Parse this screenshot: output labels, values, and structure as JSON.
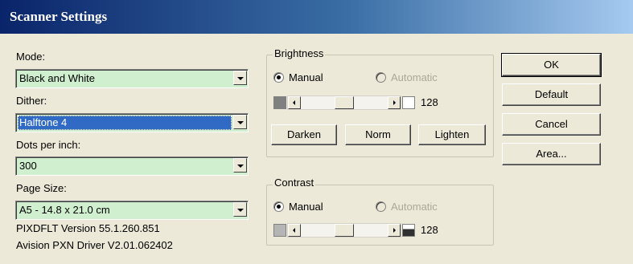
{
  "window": {
    "title": "Scanner Settings"
  },
  "left": {
    "mode_label": "Mode:",
    "mode_value": "Black and White",
    "dither_label": "Dither:",
    "dither_value": "Halftone 4",
    "dpi_label": "Dots per inch:",
    "dpi_value": "300",
    "pagesize_label": "Page Size:",
    "pagesize_value": "A5 - 14.8 x 21.0 cm",
    "version_line1": "PIXDFLT Version 55.1.260.851",
    "version_line2": "Avision PXN Driver V2.01.062402"
  },
  "brightness": {
    "legend": "Brightness",
    "manual_label": "Manual",
    "automatic_label": "Automatic",
    "mode_selected": "Manual",
    "value": "128",
    "darken_label": "Darken",
    "norm_label": "Norm",
    "lighten_label": "Lighten"
  },
  "contrast": {
    "legend": "Contrast",
    "manual_label": "Manual",
    "automatic_label": "Automatic",
    "mode_selected": "Manual",
    "value": "128"
  },
  "buttons": {
    "ok": "OK",
    "default": "Default",
    "cancel": "Cancel",
    "area": "Area..."
  },
  "colors": {
    "title_gradient_start": "#0A246A",
    "combo_bg": "#CFEFCF",
    "selection": "#316AC5",
    "dialog_bg": "#ECE9D8"
  }
}
